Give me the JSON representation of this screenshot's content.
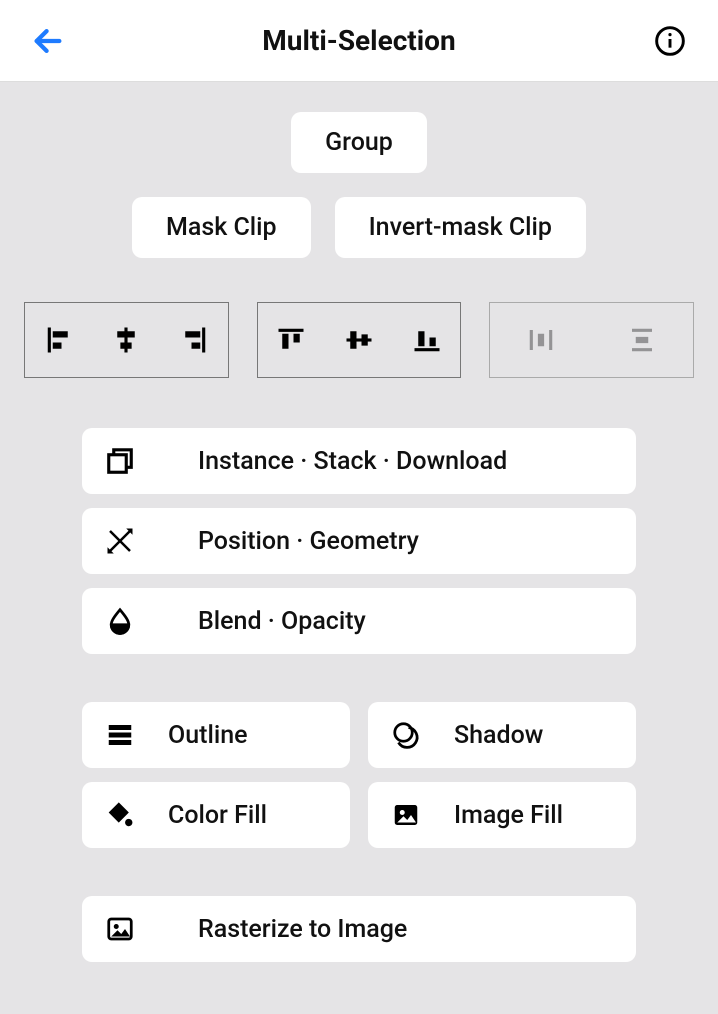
{
  "header": {
    "title": "Multi-Selection"
  },
  "actions": {
    "group": "Group",
    "mask_clip": "Mask Clip",
    "invert_mask_clip": "Invert-mask Clip"
  },
  "rows": {
    "instance": "Instance · Stack · Download",
    "position": "Position · Geometry",
    "blend": "Blend · Opacity",
    "outline": "Outline",
    "shadow": "Shadow",
    "color_fill": "Color Fill",
    "image_fill": "Image Fill",
    "rasterize": "Rasterize to Image"
  }
}
